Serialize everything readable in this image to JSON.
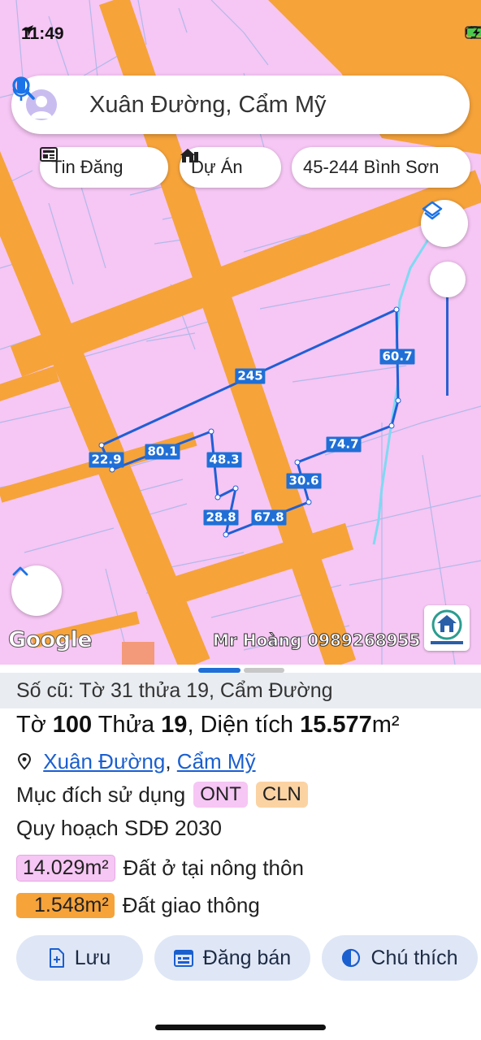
{
  "status_bar": {
    "time": "11:49"
  },
  "search": {
    "query": "Xuân Đường, Cẩm Mỹ"
  },
  "chips": {
    "listings": "Tin Đăng",
    "projects": "Dự Án",
    "place": "45-244 Bình Sơn"
  },
  "map": {
    "segment_labels": [
      "245",
      "60.7",
      "74.7",
      "30.6",
      "67.8",
      "28.8",
      "48.3",
      "80.1",
      "22.9"
    ],
    "google_label": "Google",
    "watermark": "Mr Hoàng 0989268955",
    "colors": {
      "land": "#f6c6f4",
      "road": "#f6a33a",
      "outline": "#1f5fd6"
    }
  },
  "parcel": {
    "old_info": "Số cũ: Tờ 31 thửa 19, Cẩm Đường",
    "sheet_label": "Tờ ",
    "sheet_no": "100",
    "plot_label": " Thửa ",
    "plot_no": "19",
    "area_label": ", Diện tích ",
    "area_value": "15.577",
    "area_unit": "m²",
    "commune": "Xuân Đường",
    "district": "Cẩm Mỹ",
    "purpose_label": "Mục đích sử dụng",
    "purpose_tags": [
      "ONT",
      "CLN"
    ],
    "plan_title": "Quy hoạch SDĐ 2030",
    "plan_items": [
      {
        "area": "14.029m²",
        "label": "Đất ở tại nông thôn",
        "color": "#f6c6f4"
      },
      {
        "area": "1.548m²",
        "label": "Đất giao thông",
        "color": "#f6a33a"
      }
    ]
  },
  "actions": {
    "save": "Lưu",
    "sell": "Đăng bán",
    "legend": "Chú thích"
  }
}
